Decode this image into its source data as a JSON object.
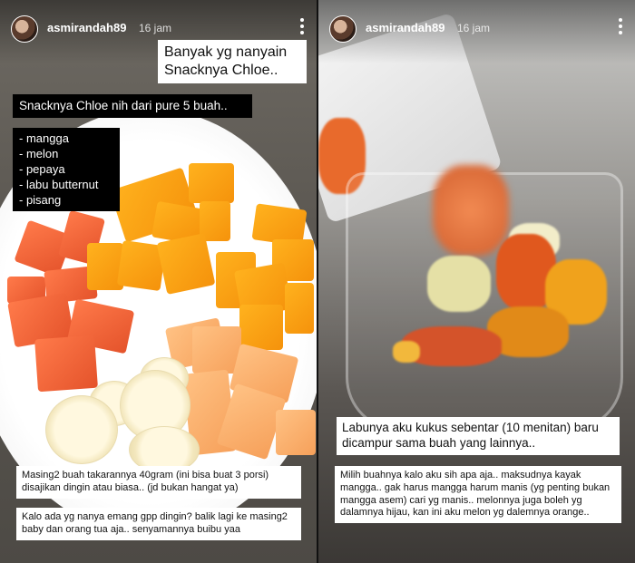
{
  "left_story": {
    "username": "asmirandah89",
    "time": "16 jam",
    "title_line1": "Banyak yg nanyain",
    "title_line2": "Snacknya Chloe..",
    "subtitle": "Snacknya Chloe nih dari pure 5 buah..",
    "fruit_list": [
      "- mangga",
      "- melon",
      "- pepaya",
      "- labu butternut",
      "- pisang"
    ],
    "caption1": "Masing2 buah takarannya 40gram (ini bisa buat 3 porsi) disajikan dingin atau biasa.. (jd bukan hangat ya)",
    "caption2": "Kalo ada yg nanya emang gpp dingin? balik lagi ke masing2 baby dan orang tua aja.. senyamannya buibu yaa"
  },
  "right_story": {
    "username": "asmirandah89",
    "time": "16 jam",
    "caption_dark": "Labunya aku kukus sebentar (10 menitan) baru dicampur sama buah yang lainnya..",
    "caption_light": "Milih buahnya kalo aku sih apa aja.. maksudnya kayak mangga.. gak harus mangga harum manis (yg penting bukan mangga asem) cari yg manis.. melonnya juga boleh yg dalamnya hijau, kan ini aku melon yg dalemnya orange.."
  },
  "icons": [
    "avatar",
    "more-options-icon"
  ],
  "colors": {
    "mango": "#f5920b",
    "papaya": "#e4532b",
    "melon": "#f6a05a",
    "caption_bg": "#ffffff",
    "dark_caption_bg": "#000000"
  }
}
